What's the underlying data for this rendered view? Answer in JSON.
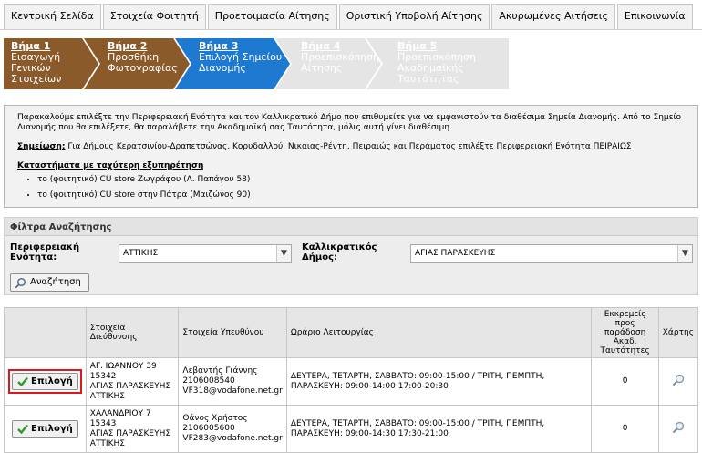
{
  "nav": {
    "tabs": [
      "Κεντρική Σελίδα",
      "Στοιχεία Φοιτητή",
      "Προετοιμασία Αίτησης",
      "Οριστική Υποβολή Αίτησης",
      "Ακυρωμένες Αιτήσεις",
      "Επικοινωνία"
    ]
  },
  "steps": [
    {
      "num": "Βήμα 1",
      "line1": "Εισαγωγή Γενικών",
      "line2": "Στοιχείων",
      "line3": ""
    },
    {
      "num": "Βήμα 2",
      "line1": "Προσθήκη",
      "line2": "Φωτογραφίας",
      "line3": ""
    },
    {
      "num": "Βήμα 3",
      "line1": "Επιλογή Σημείου",
      "line2": "Διανομής",
      "line3": ""
    },
    {
      "num": "Βήμα 4",
      "line1": "Προεπισκόπηση",
      "line2": "Αίτησης",
      "line3": ""
    },
    {
      "num": "Βήμα 5",
      "line1": "Προεπισκόπηση",
      "line2": "Ακαδημαϊκής",
      "line3": "Ταυτότητας"
    }
  ],
  "colors": {
    "step_done": "#8b5a2b",
    "step_active": "#1e7ad1",
    "step_todo": "#e5e5e5",
    "highlight": "#e0161c"
  },
  "info": {
    "para1": "Παρακαλούμε επιλέξτε την Περιφερειακή Ενότητα και τον Καλλικρατικό Δήμο που επιθυμείτε για να εμφανιστούν τα διαθέσιμα Σημεία Διανομής. Από το Σημείο Διανομής που θα επιλέξετε, θα παραλάβετε την Ακαδημαϊκή σας Ταυτότητα, μόλις αυτή γίνει διαθέσιμη.",
    "note_label": "Σημείωση:",
    "note_text": " Για Δήμους Κερατσινίου-Δραπετσώνας, Κορυδαλλού, Νικαιας-Ρέντη, Πειραιώς και Περάματος επιλέξτε Περιφερειακή Ενότητα ΠΕΙΡΑΙΩΣ",
    "shops_title": "Καταστήματα με ταχύτερη εξυπηρέτηση",
    "shops": [
      "το (φοιτητικό) CU store Ζωγράφου (Λ. Παπάγου 58)",
      "το (φοιτητικό) CU store στην Πάτρα (Μαιζώνος 90)"
    ]
  },
  "filters": {
    "title": "Φίλτρα Αναζήτησης",
    "region_label_1": "Περιφερειακή",
    "region_label_2": "Ενότητα:",
    "region_value": "ΑΤΤΙΚΗΣ",
    "municipality_label_1": "Καλλικρατικός",
    "municipality_label_2": "Δήμος:",
    "municipality_value": "ΑΓΙΑΣ ΠΑΡΑΣΚΕΥΗΣ",
    "search_label": "Αναζήτηση"
  },
  "table": {
    "headers": {
      "address": "Στοιχεία Διεύθυνσης",
      "contact": "Στοιχεία Υπευθύνου",
      "hours": "Ωράριο Λειτουργίας",
      "pending_1": "Εκκρεμείς προς",
      "pending_2": "παράδοση",
      "pending_3": "Ακαδ.",
      "pending_4": "Ταυτότητες",
      "map": "Χάρτης"
    },
    "select_label": "Επιλογή",
    "rows": [
      {
        "addr1": "ΑΓ. ΙΩΑΝΝΟΥ 39",
        "addr2": "15342",
        "addr3": "ΑΓΙΑΣ ΠΑΡΑΣΚΕΥΗΣ",
        "addr4": "ΑΤΤΙΚΗΣ",
        "name": "Λεβαντής Γιάννης",
        "phone": "2106008540",
        "email": "VF318@vodafone.net.gr",
        "hours1": "ΔΕΥΤΕΡΑ, ΤΕΤΑΡΤΗ, ΣΑΒΒΑΤΟ: 09:00-15:00 / ΤΡΙΤΗ, ΠΕΜΠΤΗ,",
        "hours2": "ΠΑΡΑΣΚΕΥΗ: 09:00-14:00 17:00-20:30",
        "pending": "0"
      },
      {
        "addr1": "ΧΑΛΑΝΔΡΙΟΥ 7",
        "addr2": "15343",
        "addr3": "ΑΓΙΑΣ ΠΑΡΑΣΚΕΥΗΣ",
        "addr4": "ΑΤΤΙΚΗΣ",
        "name": "Θάνος Χρήστος",
        "phone": "2106005600",
        "email": "VF283@vodafone.net.gr",
        "hours1": "ΔΕΥΤΕΡΑ, ΤΕΤΑΡΤΗ, ΣΑΒΒΑΤΟ: 09:00-15:00 / ΤΡΙΤΗ, ΠΕΜΠΤΗ,",
        "hours2": "ΠΑΡΑΣΚΕΥΗ: 09:00-14:30 17:30-21:00",
        "pending": "0"
      }
    ]
  }
}
